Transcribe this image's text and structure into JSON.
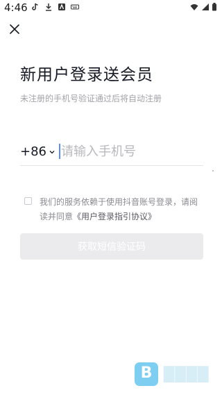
{
  "status_bar": {
    "time": "4:46",
    "left_icons": [
      "tiktok-icon",
      "download-icon",
      "app-icon",
      "keyboard-icon"
    ],
    "right_icons": [
      "wifi-icon",
      "signal-icon",
      "battery-icon"
    ]
  },
  "header": {
    "close_icon": "close-icon"
  },
  "main": {
    "title": "新用户登录送会员",
    "subtitle": "未注册的手机号验证通过后将自动注册",
    "country_code": "+86",
    "phone_placeholder": "请输入手机号",
    "agreement_text": "我们的服务依赖于使用抖音账号登录，请阅读并同意",
    "agreement_link": "《用户登录指引协议》",
    "get_code_label": "获取短信验证码"
  },
  "colors": {
    "text": "#161823",
    "muted": "#a3a3a8",
    "cursor": "#5b8dee",
    "button_disabled": "#ebebed",
    "watermark": "#6fc9f0"
  }
}
